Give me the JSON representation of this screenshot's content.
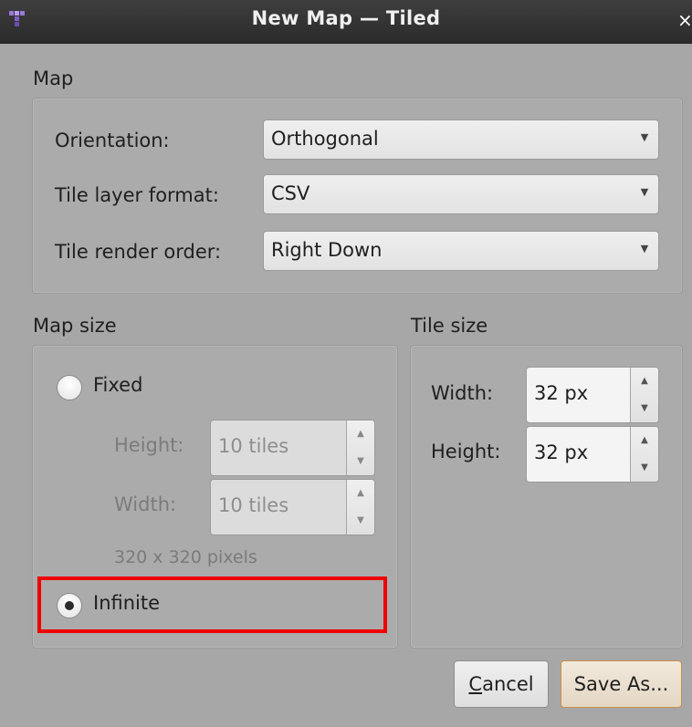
{
  "window": {
    "title": "New Map — Tiled",
    "close_glyph": "×",
    "icon": "tiled-app-icon"
  },
  "map_section": {
    "title": "Map",
    "orientation_label": "Orientation:",
    "orientation_value": "Orthogonal",
    "tile_layer_format_label": "Tile layer format:",
    "tile_layer_format_value": "CSV",
    "tile_render_order_label": "Tile render order:",
    "tile_render_order_value": "Right Down"
  },
  "map_size": {
    "title": "Map size",
    "fixed_label": "Fixed",
    "fixed_selected": false,
    "height_label": "Height:",
    "height_value": "10 tiles",
    "width_label": "Width:",
    "width_value": "10 tiles",
    "pixels_hint": "320 x 320 pixels",
    "infinite_label": "Infinite",
    "infinite_selected": true
  },
  "tile_size": {
    "title": "Tile size",
    "width_label": "Width:",
    "width_value": "32 px",
    "height_label": "Height:",
    "height_value": "32 px"
  },
  "buttons": {
    "cancel_mnemonic": "C",
    "cancel_rest": "ancel",
    "save_as_label": "Save As..."
  },
  "colors": {
    "highlight": "#ee0000",
    "dialog_bg": "#a7a7a7",
    "titlebar_bg": "#333333",
    "default_button_border": "#c98f4a"
  }
}
